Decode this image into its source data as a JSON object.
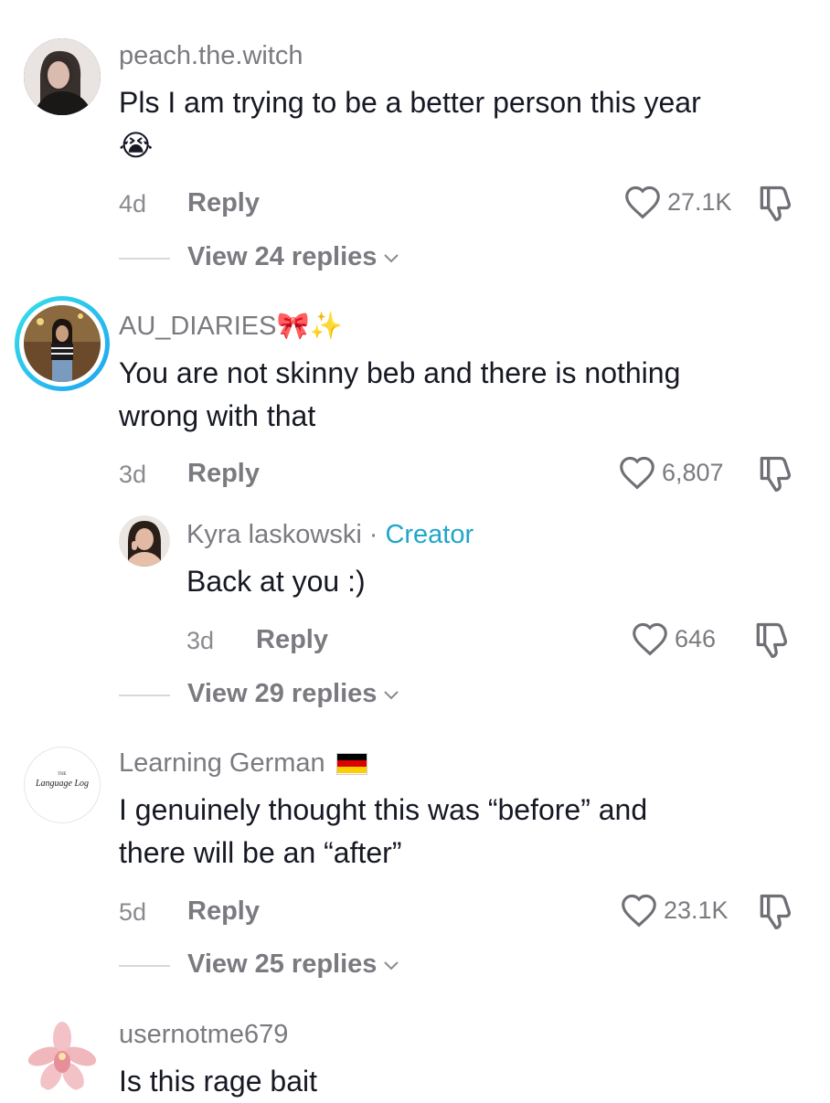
{
  "comments": [
    {
      "username": "peach.the.witch",
      "text_line1": "Pls I am trying to be a better person this year",
      "text_line2": "😭",
      "time": "4d",
      "reply_label": "Reply",
      "likes": "27.1K",
      "view_replies": "View 24 replies"
    },
    {
      "username": "AU_DIARIES🎀✨",
      "text_line1": "You are not skinny beb and there is nothing",
      "text_line2": "wrong with that",
      "time": "3d",
      "reply_label": "Reply",
      "likes": "6,807",
      "reply": {
        "username": "Kyra laskowski",
        "separator": "·",
        "badge": "Creator",
        "text": "Back at you :)",
        "time": "3d",
        "reply_label": "Reply",
        "likes": "646"
      },
      "view_replies": "View 29 replies"
    },
    {
      "username": "Learning German",
      "avatar_small": "THE",
      "avatar_text": "Language Log",
      "text_line1": "I genuinely thought this was “before” and",
      "text_line2": "there will be an “after”",
      "time": "5d",
      "reply_label": "Reply",
      "likes": "23.1K",
      "view_replies": "View 25 replies"
    },
    {
      "username": "usernotme679",
      "text_line1": "Is this rage bait"
    }
  ],
  "colors": {
    "creator": "#20a6c9",
    "text": "#161823",
    "muted": "#7a7a80",
    "story_ring_start": "#2fd6e8",
    "story_ring_end": "#22a9f0"
  },
  "icons": [
    "heart-outline-icon",
    "thumbs-down-icon",
    "chevron-down-icon",
    "german-flag-icon"
  ]
}
